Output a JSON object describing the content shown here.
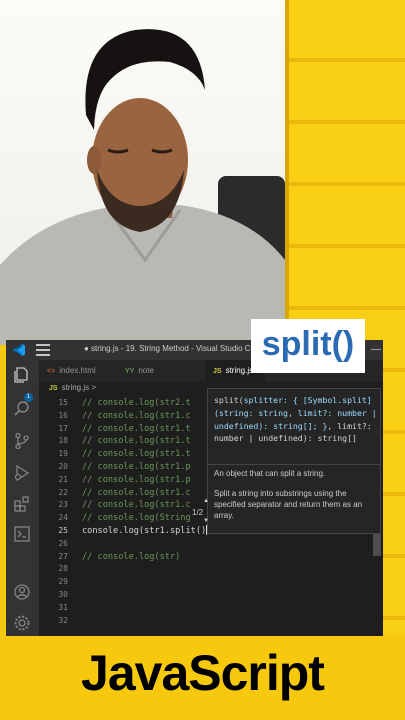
{
  "overlay_label": "split()",
  "caption": "JavaScript",
  "window": {
    "title": "● string.js - 19. String Method - Visual Studio Code",
    "minimize_glyph": "—"
  },
  "tabs": [
    {
      "icon": "<>",
      "label": "index.html",
      "active": false
    },
    {
      "icon": "YY",
      "label": "note",
      "active": false
    },
    {
      "icon": "JS",
      "label": "string.js",
      "active": true
    }
  ],
  "breadcrumb": {
    "icon": "JS",
    "label": "string.js >"
  },
  "activity_bar": {
    "icons": [
      "explorer-icon",
      "search-icon",
      "source-control-icon",
      "run-debug-icon",
      "extensions-icon",
      "terminal-icon",
      "account-icon",
      "settings-gear-icon"
    ],
    "badge": "1"
  },
  "editor": {
    "line_numbers": [
      "15",
      "16",
      "17",
      "18",
      "19",
      "20",
      "21",
      "22",
      "23",
      "24",
      "25",
      "26",
      "27",
      "28",
      "29",
      "30",
      "31",
      "32"
    ],
    "current_line": "25",
    "lines": [
      "// console.log(str2.t",
      "// console.log(str1.c",
      "// console.log(str1.t",
      "// console.log(str1.t",
      "// console.log(str1.t",
      "// console.log(str1.p",
      "// console.log(str1.p",
      "// console.log(str1.c",
      "// console.log(str1.c",
      "// console.log(String",
      "console.log(str1.split()",
      "",
      "// console.log(str)",
      "",
      "",
      "",
      "",
      ""
    ]
  },
  "hover": {
    "signature_prefix": "split(",
    "signature_param": "splitter: { [Symbol.split](string: string, limit?: number | undefined): string[]; }",
    "signature_rest": ", limit?: number | undefined): string[]",
    "doc_line1": "An object that can split a string.",
    "doc_line2": "Split a string into substrings using the specified separator and return them as an array.",
    "pager": "1/2"
  },
  "colors": {
    "accent_yellow": "#f6c90e",
    "vscode_bg": "#1e1e1e",
    "comment_green": "#6a9955",
    "label_blue": "#2a6bb3"
  }
}
